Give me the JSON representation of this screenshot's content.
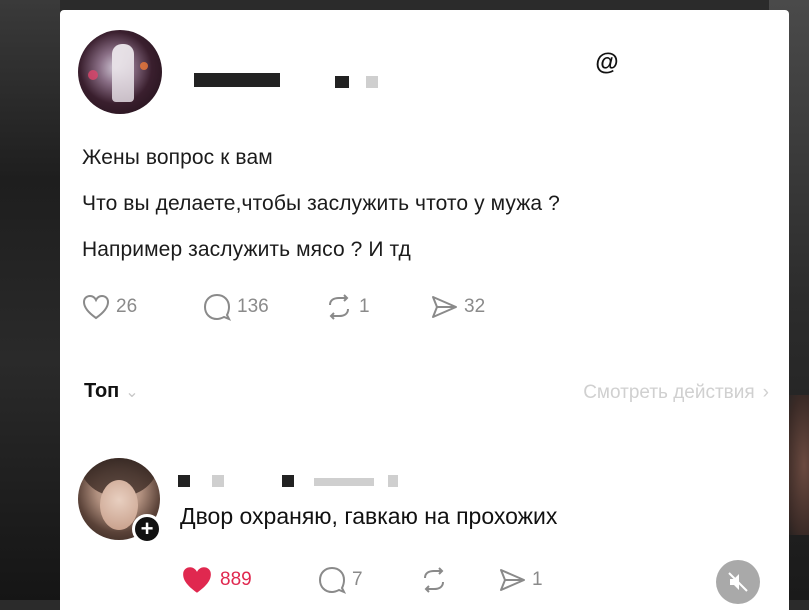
{
  "post": {
    "lines": [
      "Жены вопрос к вам",
      "Что вы делаете,чтобы заслужить чтото у мужа ?",
      "Например заслужить мясо ? И тд"
    ],
    "stats": {
      "likes": "26",
      "comments": "136",
      "reposts": "1",
      "shares": "32"
    },
    "app_icon": "threads-icon"
  },
  "sort": {
    "label": "Топ",
    "activity_link": "Смотреть действия"
  },
  "reply": {
    "text": "Двор охраняю, гавкаю на прохожих",
    "stats": {
      "likes": "889",
      "comments": "7",
      "shares": "1"
    },
    "colors": {
      "liked_heart": "#e0284f"
    }
  }
}
